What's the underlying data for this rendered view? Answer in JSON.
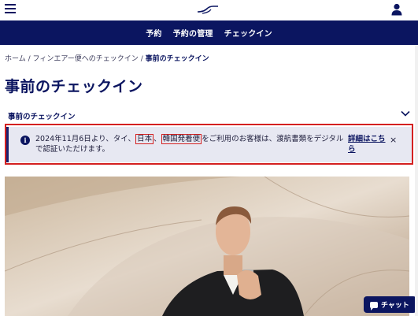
{
  "header": {
    "menu_icon": "hamburger-icon",
    "logo_icon": "finnair-logo-icon",
    "user_icon": "user-icon"
  },
  "nav": {
    "items": [
      {
        "label": "予約"
      },
      {
        "label": "予約の管理"
      },
      {
        "label": "チェックイン"
      }
    ]
  },
  "breadcrumb": {
    "home": "ホーム",
    "separator": "/",
    "parent": "フィンエアー便へのチェックイン",
    "current": "事前のチェックイン"
  },
  "page": {
    "title": "事前のチェックイン"
  },
  "accordion": {
    "label": "事前のチェックイン",
    "icon": "chevron-down-icon"
  },
  "alert": {
    "icon": "info-icon",
    "text_before": "2024年11月6日より、タイ、",
    "highlight_1": "日本",
    "text_mid": "、",
    "highlight_2": "韓国発着便",
    "text_after": "をご利用のお客様は、渡航書類をデジタルで認証いただけます。",
    "link_label": "詳細はこちら",
    "close_label": "×"
  },
  "chat": {
    "label": "チャット",
    "icon": "chat-bubble-icon"
  },
  "colors": {
    "brand_navy": "#0b1560",
    "highlight_red": "#d42020",
    "alert_bg": "#e7e8f2"
  }
}
